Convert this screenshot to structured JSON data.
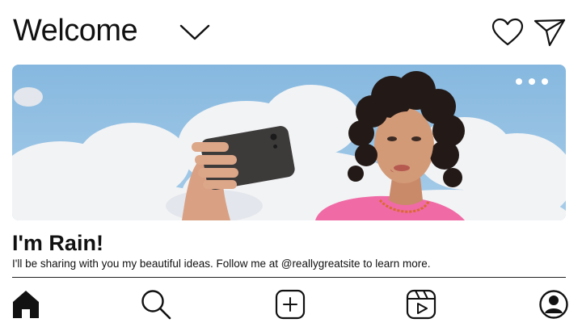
{
  "header": {
    "title": "Welcome",
    "icons": [
      "chevron-down-icon",
      "heart-icon",
      "send-icon"
    ]
  },
  "banner": {
    "description_icon": "more-options-icon",
    "colors": {
      "sky": "#8fbde0",
      "cloud": "#f3f3f4",
      "shirt": "#f06aa5",
      "phone": "#3d3a3a"
    }
  },
  "profile": {
    "name": "I'm Rain!",
    "bio": "I'll be sharing with you my beautiful ideas. Follow me at @reallygreatsite to learn more."
  },
  "bottom_nav": {
    "items": [
      "home-icon",
      "search-icon",
      "create-icon",
      "reels-icon",
      "profile-icon"
    ]
  }
}
